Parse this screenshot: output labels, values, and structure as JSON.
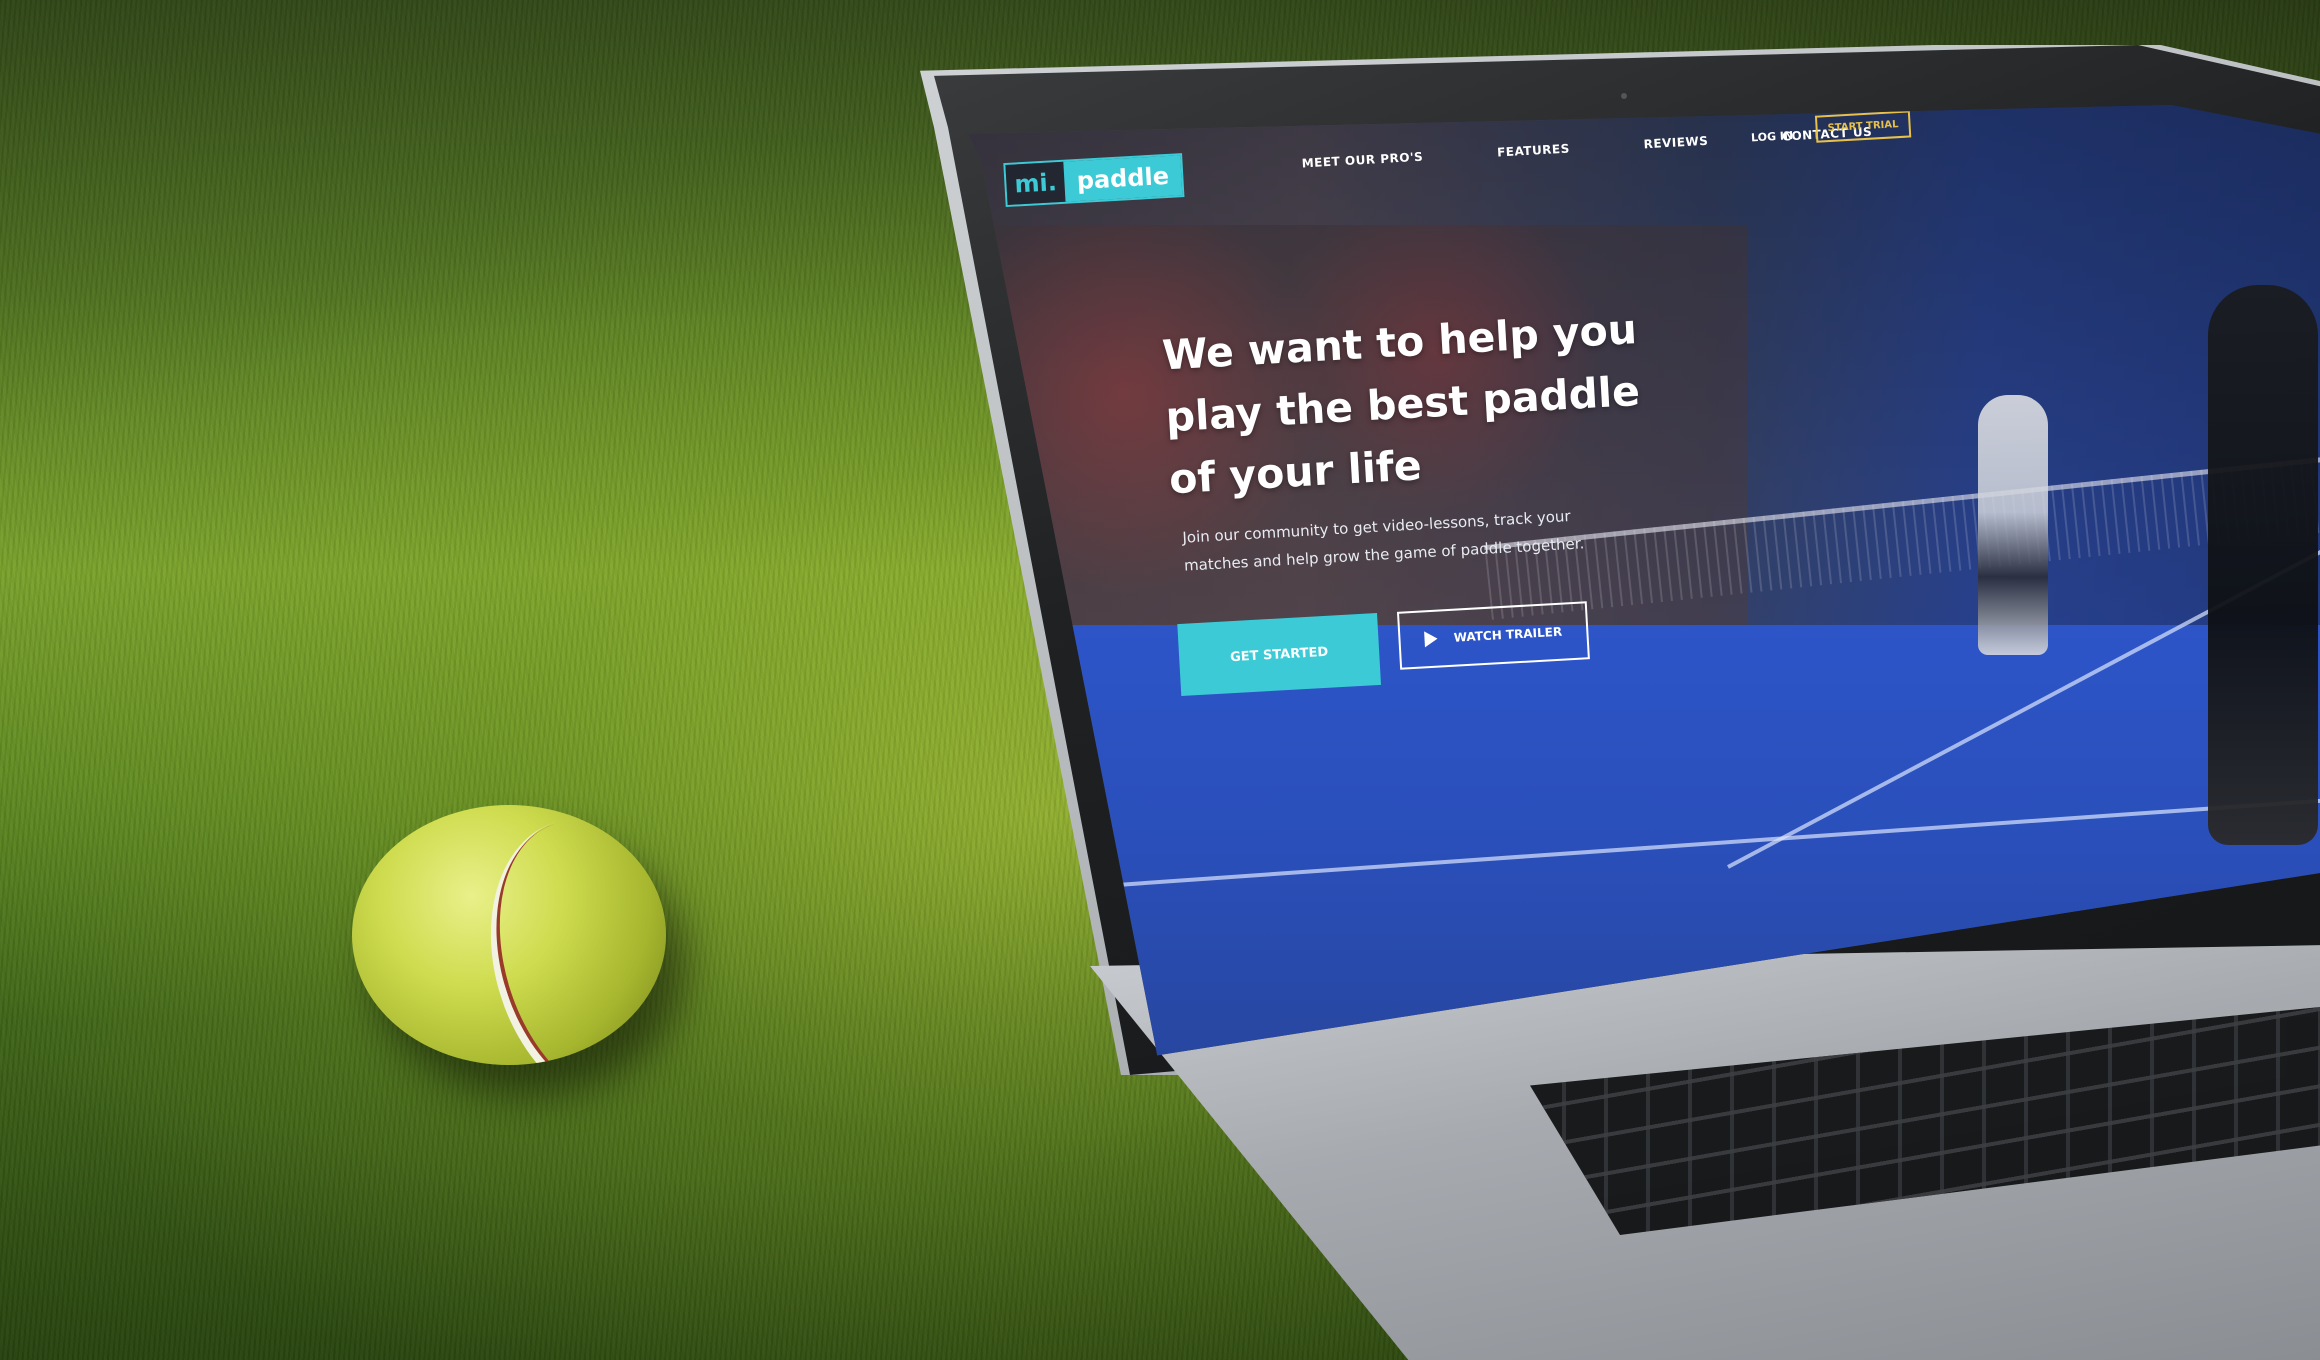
{
  "site": {
    "logo": {
      "part1": "mi.",
      "part2": "paddle"
    },
    "nav": [
      {
        "label": "MEET OUR PRO'S"
      },
      {
        "label": "FEATURES"
      },
      {
        "label": "REVIEWS"
      },
      {
        "label": "CONTACT US"
      }
    ],
    "login_label": "LOG IN",
    "trial_label": "START TRIAL",
    "hero": {
      "title": "We want to help you play the best paddle of your life",
      "subtitle": "Join our community to get video-lessons, track your matches and help grow the game of paddle together.",
      "primary_button": "GET STARTED",
      "secondary_button": "WATCH TRAILER"
    },
    "colors": {
      "accent": "#3ccbd6",
      "trial": "#e7c14a"
    }
  },
  "icons": {
    "play": "play-icon"
  }
}
